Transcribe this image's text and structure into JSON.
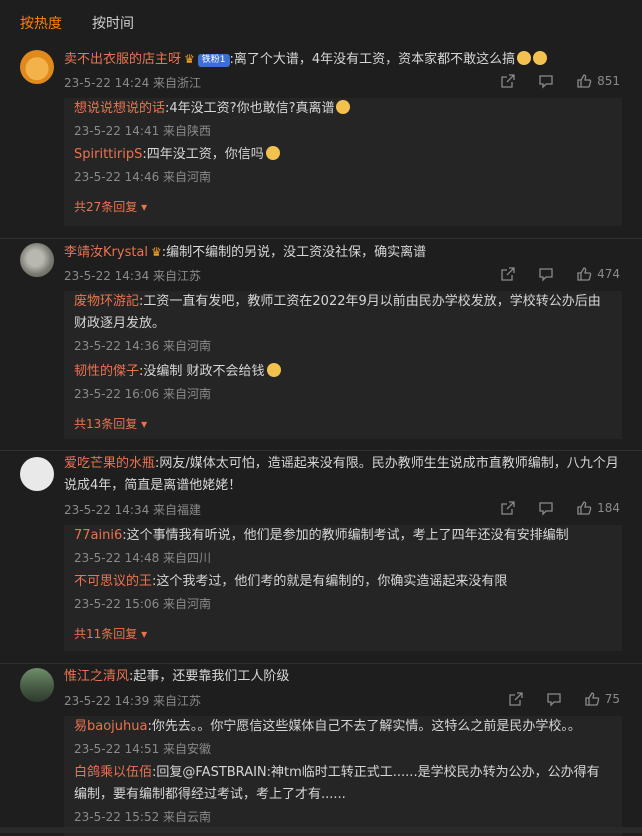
{
  "tabs": [
    "按热度",
    "按时间"
  ],
  "comments": [
    {
      "user": "卖不出衣服的店主呀",
      "badge": "铁粉1",
      "text": ":离了个大谱，4年没有工资，资本家都不敢这么搞",
      "meta": "23-5-22 14:24 来自浙江",
      "likes": "851",
      "replies": [
        {
          "user": "想说说想说的话",
          "text": ":4年没工资?你也敢信?真离谱",
          "meta": "23-5-22 14:41 来自陕西"
        },
        {
          "user": "SpirittiripS",
          "text": ":四年没工资，你信吗",
          "meta": "23-5-22 14:46 来自河南"
        }
      ],
      "more": "共27条回复"
    },
    {
      "user": "李靖汝Krystal",
      "text": ":编制不编制的另说，没工资没社保，确实离谱",
      "meta": "23-5-22 14:34 来自江苏",
      "likes": "474",
      "replies": [
        {
          "user": "废物环游記",
          "text": ":工资一直有发吧，教师工资在2022年9月以前由民办学校发放，学校转公办后由财政逐月发放。",
          "meta": "23-5-22 14:36 来自河南"
        },
        {
          "user": "韧性的傑子",
          "text": ":没编制 财政不会给钱",
          "meta": "23-5-22 16:06 来自河南"
        }
      ],
      "more": "共13条回复"
    },
    {
      "user": "爱吃芒果的水瓶",
      "text": ":网友/媒体太可怕，造谣起来没有限。民办教师生生说成市直教师编制，八九个月说成4年，简直是离谱他姥姥！",
      "meta": "23-5-22 14:34 来自福建",
      "likes": "184",
      "replies": [
        {
          "user": "77aini6",
          "text": ":这个事情我有听说，他们是参加的教师编制考试，考上了四年还没有安排编制",
          "meta": "23-5-22 14:48 来自四川"
        },
        {
          "user": "不可思议的王",
          "text": ":这个我考过，他们考的就是有编制的，你确实造谣起来没有限",
          "meta": "23-5-22 15:06 来自河南"
        }
      ],
      "more": "共11条回复"
    },
    {
      "user": "惟江之清风",
      "text": ":起事，还要靠我们工人阶级",
      "meta": "23-5-22 14:39 来自江苏",
      "likes": "75",
      "replies": [
        {
          "user": "易baojuhua",
          "text": ":你先去。。你宁愿信这些媒体自己不去了解实情。这特么之前是民办学校。。",
          "meta": "23-5-22 14:51 来自安徽"
        },
        {
          "user": "白鸽乘以伍佰",
          "text": ":回复@FASTBRAIN:神tm临时工转正式工......是学校民办转为公办，公办得有编制，要有编制都得经过考试，考上了才有......",
          "meta": "23-5-22 15:52 来自云南"
        }
      ]
    }
  ]
}
